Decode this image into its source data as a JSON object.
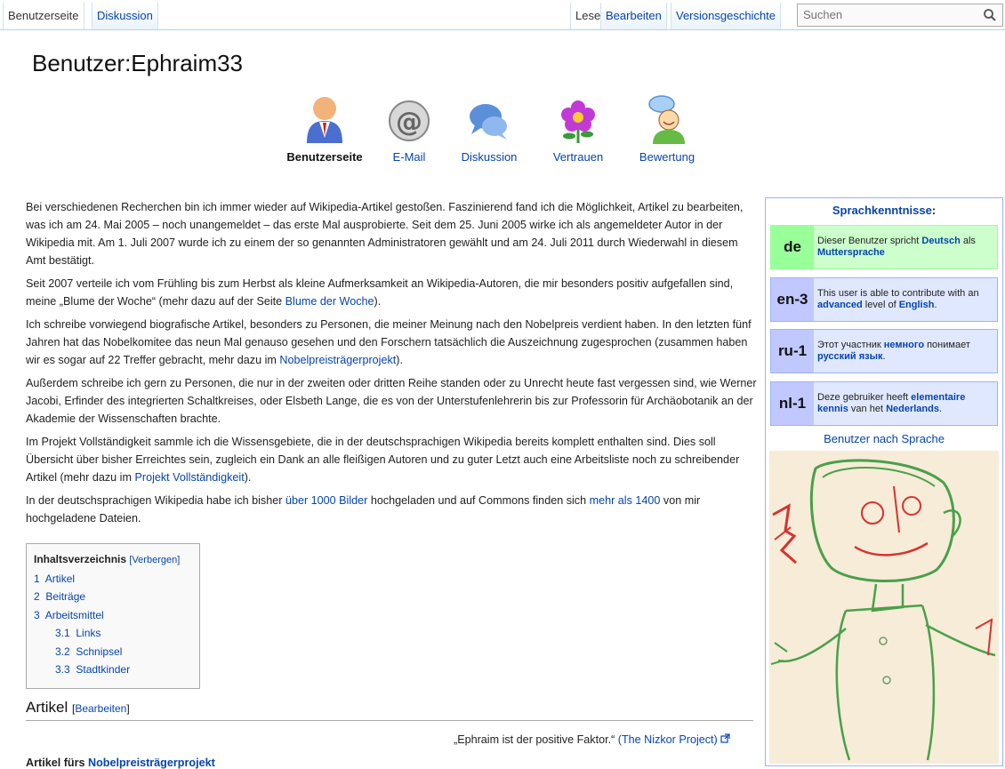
{
  "tabs_left": [
    "Benutzerseite",
    "Diskussion"
  ],
  "tabs_right": [
    "Lesen",
    "Bearbeiten",
    "Versionsgeschichte"
  ],
  "search": {
    "placeholder": "Suchen"
  },
  "page_title": "Benutzer:Ephraim33",
  "icon_nav": [
    {
      "label": "Benutzerseite",
      "icon": "user-icon"
    },
    {
      "label": "E-Mail",
      "icon": "email-at-icon"
    },
    {
      "label": "Diskussion",
      "icon": "speech-bubbles-icon"
    },
    {
      "label": "Vertrauen",
      "icon": "flower-icon"
    },
    {
      "label": "Bewertung",
      "icon": "smiley-chat-icon"
    }
  ],
  "paragraphs": {
    "p1": "Bei verschiedenen Recherchen bin ich immer wieder auf Wikipedia-Artikel gestoßen. Faszinierend fand ich die Möglichkeit, Artikel zu bearbeiten, was ich am 24. Mai 2005 – noch unangemeldet – das erste Mal ausprobierte. Seit dem 25. Juni 2005 wirke ich als angemeldeter Autor in der Wikipedia mit. Am 1. Juli 2007 wurde ich zu einem der so genannten Administratoren gewählt und am 24. Juli 2011 durch Wiederwahl in diesem Amt bestätigt.",
    "p2_a": "Seit 2007 verteile ich vom Frühling bis zum Herbst als kleine Aufmerksamkeit an Wikipedia-Autoren, die mir besonders positiv aufgefallen sind, meine „Blume der Woche“ (mehr dazu auf der Seite ",
    "p2_link": "Blume der Woche",
    "p2_b": ").",
    "p3_a": "Ich schreibe vorwiegend biografische Artikel, besonders zu Personen, die meiner Meinung nach den Nobelpreis verdient haben. In den letzten fünf Jahren hat das Nobelkomitee das neun Mal genauso gesehen und den Forschern tatsächlich die Auszeichnung zugesprochen (zusammen haben wir es sogar auf 22 Treffer gebracht, mehr dazu im ",
    "p3_link": "Nobelpreisträgerprojekt",
    "p3_b": ").",
    "p4": "Außerdem schreibe ich gern zu Personen, die nur in der zweiten oder dritten Reihe standen oder zu Unrecht heute fast vergessen sind, wie Werner Jacobi, Erfinder des integrierten Schaltkreises, oder Elsbeth Lange, die es von der Unterstufenlehrerin bis zur Professorin für Archäobotanik an der Akademie der Wissenschaften brachte.",
    "p5_a": "Im Projekt Vollständigkeit sammle ich die Wissensgebiete, die in der deutschsprachigen Wikipedia bereits komplett enthalten sind. Dies soll Übersicht über bisher Erreichtes sein, zugleich ein Dank an alle fleißigen Autoren und zu guter Letzt auch eine Arbeitsliste noch zu schreibender Artikel (mehr dazu im ",
    "p5_link": "Projekt Vollständigkeit",
    "p5_b": ").",
    "p6_a": "In der deutschsprachigen Wikipedia habe ich bisher ",
    "p6_link1": "über 1000 Bilder",
    "p6_b": " hochgeladen und auf Commons finden sich ",
    "p6_link2": "mehr als 1400",
    "p6_c": " von mir hochgeladene Dateien."
  },
  "toc": {
    "title": "Inhaltsverzeichnis",
    "toggle": "[Verbergen]",
    "items": [
      {
        "num": "1",
        "label": "Artikel",
        "level": 1
      },
      {
        "num": "2",
        "label": "Beiträge",
        "level": 1
      },
      {
        "num": "3",
        "label": "Arbeitsmittel",
        "level": 1
      },
      {
        "num": "3.1",
        "label": "Links",
        "level": 2
      },
      {
        "num": "3.2",
        "label": "Schnipsel",
        "level": 2
      },
      {
        "num": "3.3",
        "label": "Stadtkinder",
        "level": 2
      }
    ]
  },
  "section": {
    "heading": "Artikel",
    "edit_open": "[",
    "edit_link": "Bearbeiten",
    "edit_close": "]"
  },
  "quote": {
    "text": "„Ephraim ist der positive Faktor.“ ",
    "source": "(The Nizkor Project)"
  },
  "subheading": {
    "text": "Artikel fürs ",
    "link": "Nobelpreisträgerprojekt"
  },
  "sidebar": {
    "title": "Sprachkenntnisse",
    "colon": ":",
    "babel": [
      {
        "code": "de",
        "pre": "Dieser Benutzer spricht ",
        "b1": "Deutsch",
        "mid": " als ",
        "b2": "Muttersprache",
        "post": ""
      },
      {
        "code": "en-3",
        "pre": "This user is able to contribute with an ",
        "b1": "advanced",
        "mid": " level of ",
        "b2": "English",
        "post": "."
      },
      {
        "code": "ru-1",
        "pre": "Этот участник ",
        "b1": "немного",
        "mid": " понимает ",
        "b2": "русский язык",
        "post": "."
      },
      {
        "code": "nl-1",
        "pre": "Deze gebruiker heeft ",
        "b1": "elementaire kennis",
        "mid": " van het ",
        "b2": "Nederlands",
        "post": "."
      }
    ],
    "link": "Benutzer nach Sprache"
  },
  "colors": {
    "link": "#0645ad",
    "tab_border": "#a7d7f9",
    "babel_de": "#ccffcc",
    "babel_other": "#e0e8ff"
  }
}
